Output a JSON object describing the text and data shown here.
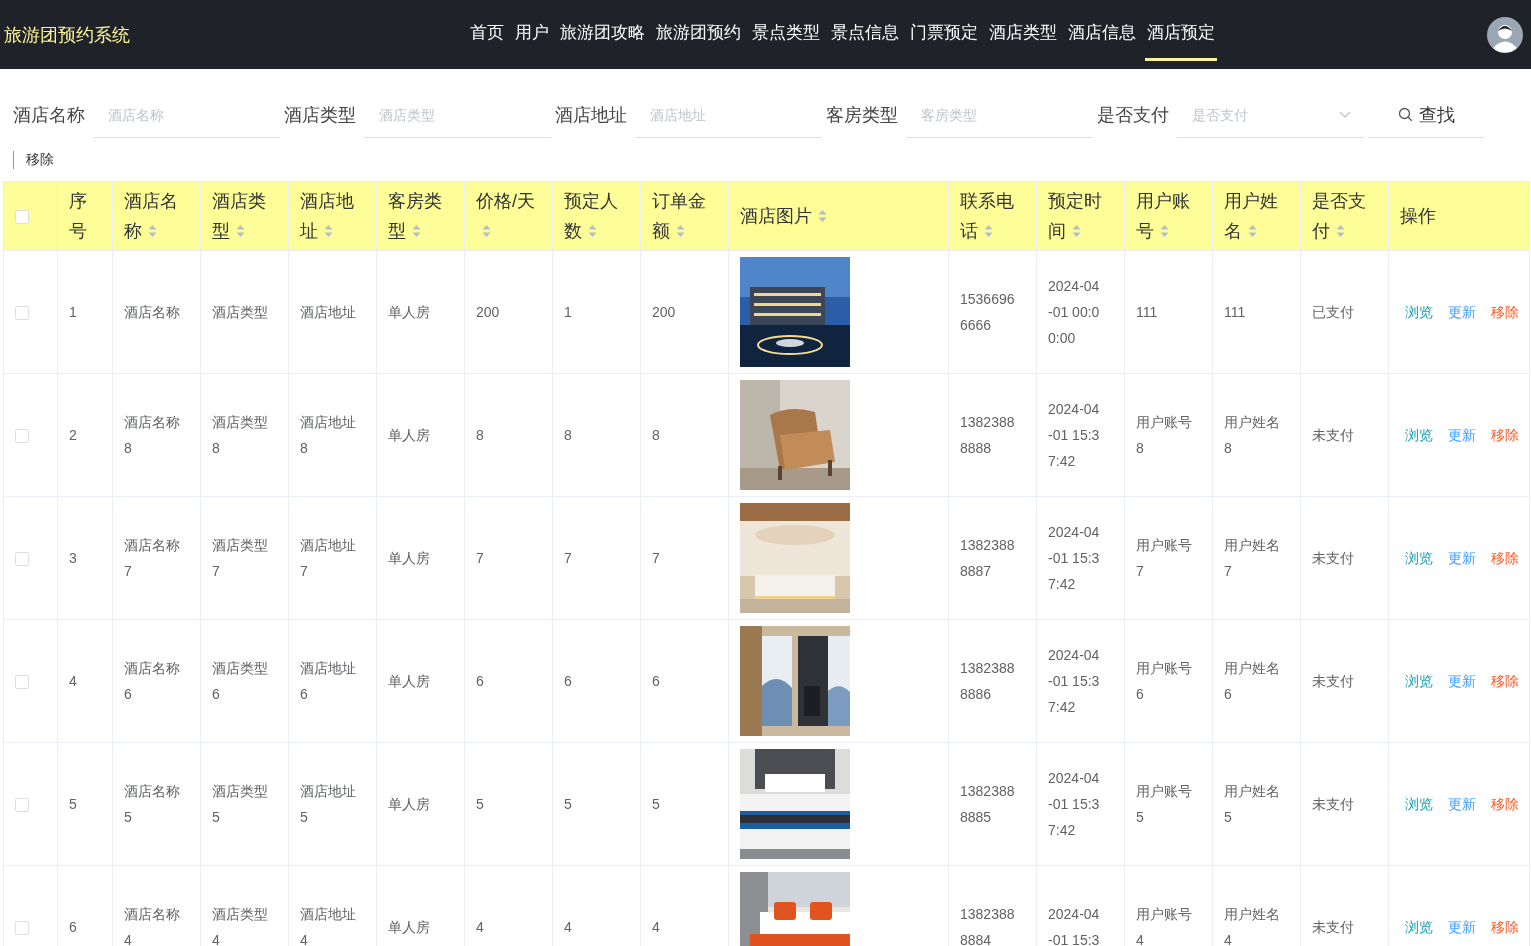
{
  "header": {
    "title": "旅游团预约系统",
    "nav": [
      {
        "label": "首页",
        "selected": false
      },
      {
        "label": "用户",
        "selected": false
      },
      {
        "label": "旅游团攻略",
        "selected": false
      },
      {
        "label": "旅游团预约",
        "selected": false
      },
      {
        "label": "景点类型",
        "selected": false
      },
      {
        "label": "景点信息",
        "selected": false
      },
      {
        "label": "门票预定",
        "selected": false
      },
      {
        "label": "酒店类型",
        "selected": false
      },
      {
        "label": "酒店信息",
        "selected": false
      },
      {
        "label": "酒店预定",
        "selected": true
      }
    ]
  },
  "filters": [
    {
      "kind": "input",
      "label": "酒店名称",
      "placeholder": "酒店名称"
    },
    {
      "kind": "input",
      "label": "酒店类型",
      "placeholder": "酒店类型"
    },
    {
      "kind": "input",
      "label": "酒店地址",
      "placeholder": "酒店地址"
    },
    {
      "kind": "input",
      "label": "客房类型",
      "placeholder": "客房类型"
    },
    {
      "kind": "select",
      "label": "是否支付",
      "placeholder": "是否支付"
    }
  ],
  "search_button": "查找",
  "remove_button": "移除",
  "table": {
    "select_all": {
      "checked": false
    },
    "columns": [
      {
        "label": "序号",
        "sortable": false
      },
      {
        "label": "酒店名称",
        "sortable": true
      },
      {
        "label": "酒店类型",
        "sortable": true
      },
      {
        "label": "酒店地址",
        "sortable": true
      },
      {
        "label": "客房类型",
        "sortable": true
      },
      {
        "label": "价格/天",
        "sortable": true
      },
      {
        "label": "预定人数",
        "sortable": true
      },
      {
        "label": "订单金额",
        "sortable": true
      },
      {
        "label": "酒店图片",
        "sortable": true
      },
      {
        "label": "联系电话",
        "sortable": true
      },
      {
        "label": "预定时间",
        "sortable": true
      },
      {
        "label": "用户账号",
        "sortable": true
      },
      {
        "label": "用户姓名",
        "sortable": true
      },
      {
        "label": "是否支付",
        "sortable": true
      },
      {
        "label": "操作",
        "sortable": false
      }
    ],
    "rows": [
      {
        "checked": false,
        "cells": [
          "1",
          "酒店名称",
          "酒店类型",
          "酒店地址",
          "单人房",
          "200",
          "1",
          "200",
          {
            "kind": "picture"
          },
          "15366966666",
          "2024-04-01 00:00:00",
          "111",
          "111",
          "已支付"
        ],
        "actions": [
          {
            "kind": "view",
            "label": "浏览"
          },
          {
            "kind": "edit",
            "label": "更新"
          },
          {
            "kind": "delete",
            "label": "移除"
          }
        ]
      },
      {
        "checked": false,
        "cells": [
          "2",
          "酒店名称8",
          "酒店类型8",
          "酒店地址8",
          "单人房",
          "8",
          "8",
          "8",
          {
            "kind": "picture"
          },
          "13823888888",
          "2024-04-01 15:37:42",
          "用户账号8",
          "用户姓名8",
          "未支付"
        ],
        "actions": [
          {
            "kind": "view",
            "label": "浏览"
          },
          {
            "kind": "edit",
            "label": "更新"
          },
          {
            "kind": "delete",
            "label": "移除"
          }
        ]
      },
      {
        "checked": false,
        "cells": [
          "3",
          "酒店名称7",
          "酒店类型7",
          "酒店地址7",
          "单人房",
          "7",
          "7",
          "7",
          {
            "kind": "picture"
          },
          "13823888887",
          "2024-04-01 15:37:42",
          "用户账号7",
          "用户姓名7",
          "未支付"
        ],
        "actions": [
          {
            "kind": "view",
            "label": "浏览"
          },
          {
            "kind": "edit",
            "label": "更新"
          },
          {
            "kind": "delete",
            "label": "移除"
          }
        ]
      },
      {
        "checked": false,
        "cells": [
          "4",
          "酒店名称6",
          "酒店类型6",
          "酒店地址6",
          "单人房",
          "6",
          "6",
          "6",
          {
            "kind": "picture"
          },
          "13823888886",
          "2024-04-01 15:37:42",
          "用户账号6",
          "用户姓名6",
          "未支付"
        ],
        "actions": [
          {
            "kind": "view",
            "label": "浏览"
          },
          {
            "kind": "edit",
            "label": "更新"
          },
          {
            "kind": "delete",
            "label": "移除"
          }
        ]
      },
      {
        "checked": false,
        "cells": [
          "5",
          "酒店名称5",
          "酒店类型5",
          "酒店地址5",
          "单人房",
          "5",
          "5",
          "5",
          {
            "kind": "picture"
          },
          "13823888885",
          "2024-04-01 15:37:42",
          "用户账号5",
          "用户姓名5",
          "未支付"
        ],
        "actions": [
          {
            "kind": "view",
            "label": "浏览"
          },
          {
            "kind": "edit",
            "label": "更新"
          },
          {
            "kind": "delete",
            "label": "移除"
          }
        ]
      },
      {
        "checked": false,
        "cells": [
          "6",
          "酒店名称4",
          "酒店类型4",
          "酒店地址4",
          "单人房",
          "4",
          "4",
          "4",
          {
            "kind": "picture"
          },
          "13823888884",
          "2024-04-01 15:3",
          "用户账号4",
          "用户姓名4",
          "未支付"
        ],
        "actions": [
          {
            "kind": "view",
            "label": "浏览"
          },
          {
            "kind": "edit",
            "label": "更新"
          },
          {
            "kind": "delete",
            "label": "移除"
          }
        ]
      }
    ]
  }
}
